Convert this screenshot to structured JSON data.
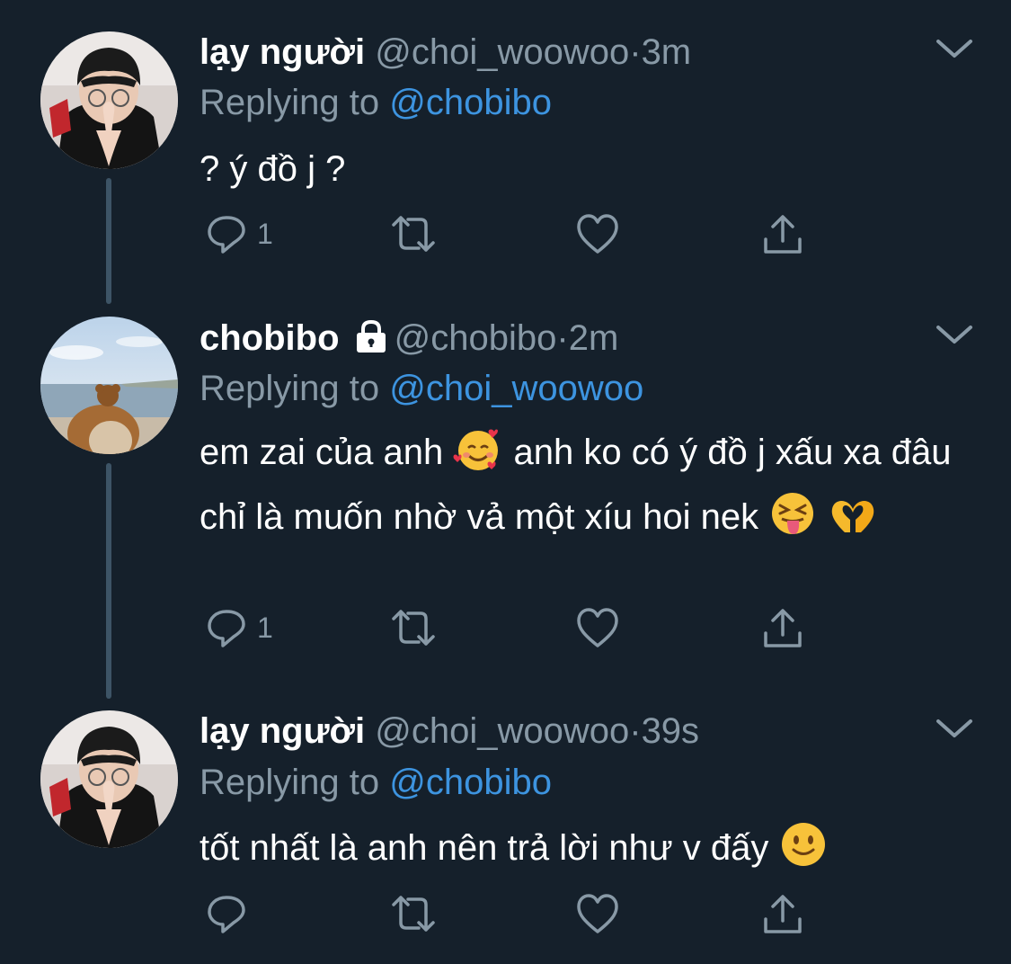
{
  "tweets": [
    {
      "name": "lạy người",
      "handle": "@choi_woowoo",
      "dot": "·",
      "time": "3m",
      "replying_prefix": "Replying to ",
      "replying_to": "@chobibo",
      "text": "? ý đồ j ?",
      "reply_count": "1",
      "avatar": "person-praying-avatar"
    },
    {
      "name": "chobibo",
      "handle": "@chobibo",
      "dot": "·",
      "time": "2m",
      "replying_prefix": "Replying to ",
      "replying_to": "@choi_woowoo",
      "text_part1": "em zai của anh",
      "text_part2": "anh ko có ý đồ j xấu xa đâu chỉ là muốn nhờ vả một xíu hoi nek",
      "emojis": [
        "smiling-face-with-hearts-emoji",
        "squinting-tongue-emoji",
        "heart-hands-emoji"
      ],
      "reply_count": "1",
      "avatar": "beach-teddy-bear-avatar",
      "protected": true
    },
    {
      "name": "lạy người",
      "handle": "@choi_woowoo",
      "dot": "·",
      "time": "39s",
      "replying_prefix": "Replying to ",
      "replying_to": "@chobibo",
      "text": "tốt nhất là anh nên trả lời như v đấy",
      "emojis": [
        "slightly-smiling-face-emoji"
      ],
      "reply_count": "",
      "avatar": "person-praying-avatar"
    }
  ],
  "colors": {
    "background": "#15202b",
    "secondary_text": "#8899a6",
    "mention": "#3d94e0",
    "thread_line": "#3d5466"
  }
}
